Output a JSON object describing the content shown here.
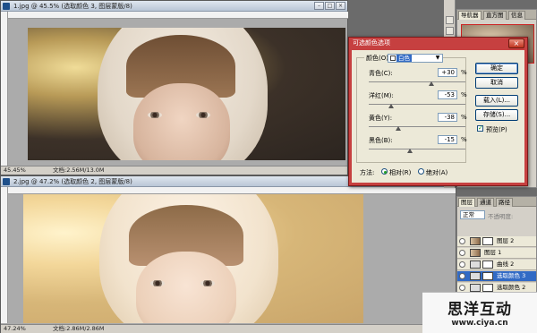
{
  "doc1": {
    "title": "1.jpg @ 45.5% (选取颜色 3, 图层蒙版/8)",
    "zoom": "45.45%",
    "doc_info": "文档:2.56M/13.0M"
  },
  "doc2": {
    "title": "2.jpg @ 47.2% (选取颜色 2, 图层蒙版/8)",
    "zoom": "47.24%",
    "doc_info": "文档:2.86M/2.86M"
  },
  "window_buttons": {
    "minimize": "–",
    "maximize": "□",
    "close": "×"
  },
  "dialog": {
    "title": "可选颜色选项",
    "close": "×",
    "color_label": "颜色(O):",
    "color_value": "白色",
    "sliders": [
      {
        "label": "青色(C):",
        "value": "+30",
        "unit": "%",
        "level": 30
      },
      {
        "label": "洋红(M):",
        "value": "-53",
        "unit": "%",
        "level": -53
      },
      {
        "label": "黄色(Y):",
        "value": "-38",
        "unit": "%",
        "level": -38
      },
      {
        "label": "黑色(B):",
        "value": "-15",
        "unit": "%",
        "level": -15
      }
    ],
    "method_label": "方法:",
    "method_relative": "相对(R)",
    "method_absolute": "绝对(A)",
    "buttons": {
      "ok": "确定",
      "cancel": "取消",
      "load": "载入(L)...",
      "save": "存储(S)...",
      "preview": "预览(P)"
    }
  },
  "panels": {
    "nav_tabs": [
      "导航器",
      "直方图",
      "信息"
    ],
    "layers_tabs": [
      "图层",
      "通道",
      "路径"
    ],
    "blend_mode": "正常",
    "opacity": "不透明度:",
    "layers": [
      {
        "name": "图层 2",
        "selected": false
      },
      {
        "name": "图层 1",
        "selected": false
      },
      {
        "name": "曲线 2",
        "selected": false
      },
      {
        "name": "选取颜色 3",
        "selected": true
      },
      {
        "name": "选取颜色 2",
        "selected": false
      }
    ]
  },
  "watermark": {
    "line1": "思洋互动",
    "line2": "www.ciya.cn"
  }
}
